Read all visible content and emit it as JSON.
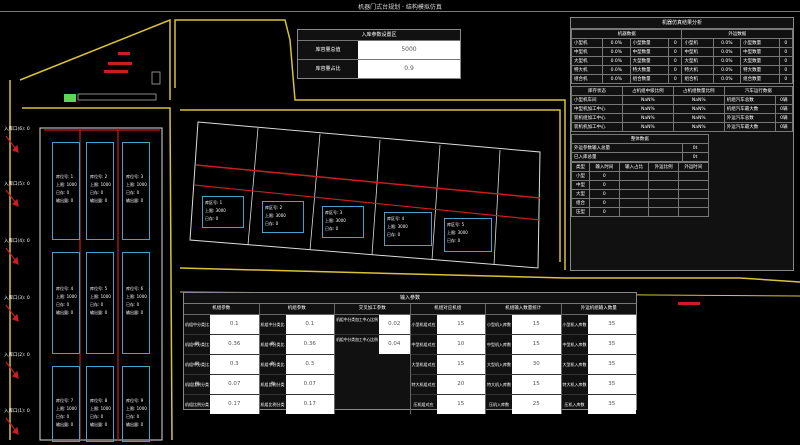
{
  "window": {
    "title": "机器门式台规划 · 结构模拟仿真"
  },
  "top_panel": {
    "title": "入库参数设置区",
    "rows": [
      {
        "label": "库容量总值",
        "value": "5000"
      },
      {
        "label": "库容量占比",
        "value": "0.9"
      }
    ]
  },
  "right_panel": {
    "title": "机器仿真结果分析",
    "section1_headers": [
      "机器数据",
      "外运数据"
    ],
    "section1_rows": [
      [
        "小型机",
        "0.0%",
        "小型数量",
        "0",
        "小型机",
        "0.0%",
        "小型数量",
        "0"
      ],
      [
        "中型机",
        "0.0%",
        "中型数量",
        "0",
        "中型机",
        "0.0%",
        "中型数量",
        "0"
      ],
      [
        "大型机",
        "0.0%",
        "大型数量",
        "0",
        "大型机",
        "0.0%",
        "大型数量",
        "0"
      ],
      [
        "特大机",
        "0.0%",
        "特大数量",
        "0",
        "特大机",
        "0.0%",
        "特大数量",
        "0"
      ],
      [
        "组合机",
        "0.0%",
        "组合数量",
        "0",
        "组合机",
        "0.0%",
        "组合数量",
        "0"
      ]
    ],
    "section2_headers": [
      "库存状态",
      "占机组中级比例",
      "占机组数量比例",
      "汽车运行数据"
    ],
    "section2_rows": [
      [
        "小型机车间",
        "NaN%",
        "NaN%",
        "机组汽车总数",
        "0辆"
      ],
      [
        "中型机加工中心",
        "NaN%",
        "NaN%",
        "机组汽车最大数",
        "0辆"
      ],
      [
        "装机组加工中心",
        "NaN%",
        "NaN%",
        "外运汽车总数",
        "0辆"
      ],
      [
        "装机机加工中心",
        "NaN%",
        "NaN%",
        "外运汽车最大数",
        "0辆"
      ]
    ],
    "section3_title": "整体数据",
    "section3_rows": [
      [
        "外运参数输入总量",
        "0t"
      ],
      [
        "已入库总量",
        "0t"
      ]
    ],
    "section4_headers": [
      "类型",
      "输入时间",
      "输入占比",
      "外运比例",
      "外运时间"
    ],
    "section4_rows": [
      [
        "小型",
        "0",
        "",
        "",
        ""
      ],
      [
        "中型",
        "0",
        "",
        "",
        ""
      ],
      [
        "大型",
        "0",
        "",
        "",
        ""
      ],
      [
        "组合",
        "0",
        "",
        "",
        ""
      ],
      [
        "压型",
        "0",
        "",
        "",
        ""
      ]
    ]
  },
  "bottom_panel": {
    "title": "输入参数",
    "col_headers": [
      "机组参数",
      "机组参数",
      "交叉加工参数",
      "机组对应机组",
      "机组输入数量统计",
      "外运机组输入数量"
    ],
    "col1": [
      {
        "label": "机组中分类比例",
        "value": "0.1"
      },
      {
        "label": "机组中分类比例",
        "value": "0.36"
      },
      {
        "label": "机组中分类比例",
        "value": "0.3"
      },
      {
        "label": "机组比例分类",
        "value": "0.07"
      },
      {
        "label": "机组比例分类",
        "value": "0.17"
      }
    ],
    "col2": [
      {
        "label": "机组中分类比例",
        "value": "0.1"
      },
      {
        "label": "机组中分类比例",
        "value": "0.36"
      },
      {
        "label": "机组中分类比例",
        "value": "0.3"
      },
      {
        "label": "机组比例分类",
        "value": "0.07"
      },
      {
        "label": "机组比例分类",
        "value": "0.17"
      }
    ],
    "col3": [
      {
        "label": "机组中分类加工中心比例",
        "value": "0.02"
      },
      {
        "label": "机组中分类加工中心比例",
        "value": "0.04"
      }
    ],
    "col4": [
      {
        "label": "小型机组对应",
        "value": "15"
      },
      {
        "label": "中型机组对应",
        "value": "10"
      },
      {
        "label": "大型机组对应",
        "value": "15"
      },
      {
        "label": "特大机组对应",
        "value": "20"
      },
      {
        "label": "压机组对应",
        "value": "15"
      }
    ],
    "col5": [
      {
        "label": "小型机入库数",
        "value": "15"
      },
      {
        "label": "中型机入库数",
        "value": "15"
      },
      {
        "label": "大型机入库数",
        "value": "30"
      },
      {
        "label": "特大机入库数",
        "value": "15"
      },
      {
        "label": "压机入库数",
        "value": "25"
      }
    ],
    "col6": [
      {
        "label": "小型机入库数",
        "value": "35"
      },
      {
        "label": "中型机入库数",
        "value": "35"
      },
      {
        "label": "大型机入库数",
        "value": "35"
      },
      {
        "label": "特大机入库数",
        "value": "35"
      },
      {
        "label": "压机入库数",
        "value": "35"
      }
    ]
  },
  "left_entries": [
    {
      "label": "入库口(6):",
      "value": "0"
    },
    {
      "label": "入库口(5):",
      "value": "0"
    },
    {
      "label": "入库口(4):",
      "value": "0"
    },
    {
      "label": "入库口(3):",
      "value": "0"
    },
    {
      "label": "入库口(2):",
      "value": "0"
    },
    {
      "label": "入库口(1):",
      "value": "0"
    }
  ],
  "center_bays": [
    {
      "name": "库区号: 1",
      "cap": "上限: 3000",
      "used": "已存: 0"
    },
    {
      "name": "库区号: 2",
      "cap": "上限: 3000",
      "used": "已存: 0"
    },
    {
      "name": "库区号: 3",
      "cap": "上限: 3000",
      "used": "已存: 0"
    },
    {
      "name": "库区号: 4",
      "cap": "上限: 3000",
      "used": "已存: 0"
    },
    {
      "name": "库区号: 5",
      "cap": "上限: 3000",
      "used": "已存: 0"
    }
  ],
  "docks": [
    {
      "name": "库位号: 1",
      "cap": "上限: 1000",
      "used": "已存: 0",
      "flow": "输出量: 0"
    },
    {
      "name": "库位号: 2",
      "cap": "上限: 1000",
      "used": "已存: 0",
      "flow": "输出量: 0"
    },
    {
      "name": "库位号: 3",
      "cap": "上限: 1000",
      "used": "已存: 0",
      "flow": "输出量: 0"
    },
    {
      "name": "库位号: 4",
      "cap": "上限: 1000",
      "used": "已存: 0",
      "flow": "输出量: 0"
    },
    {
      "name": "库位号: 5",
      "cap": "上限: 1000",
      "used": "已存: 0",
      "flow": "输出量: 0"
    },
    {
      "name": "库位号: 6",
      "cap": "上限: 1000",
      "used": "已存: 0",
      "flow": "输出量: 0"
    },
    {
      "name": "库位号: 7",
      "cap": "上限: 1000",
      "used": "已存: 0",
      "flow": "输出量: 0"
    },
    {
      "name": "库位号: 8",
      "cap": "上限: 1000",
      "used": "已存: 0",
      "flow": "输出量: 0"
    },
    {
      "name": "库位号: 9",
      "cap": "上限: 1000",
      "used": "已存: 0",
      "flow": "输出量: 0"
    }
  ]
}
